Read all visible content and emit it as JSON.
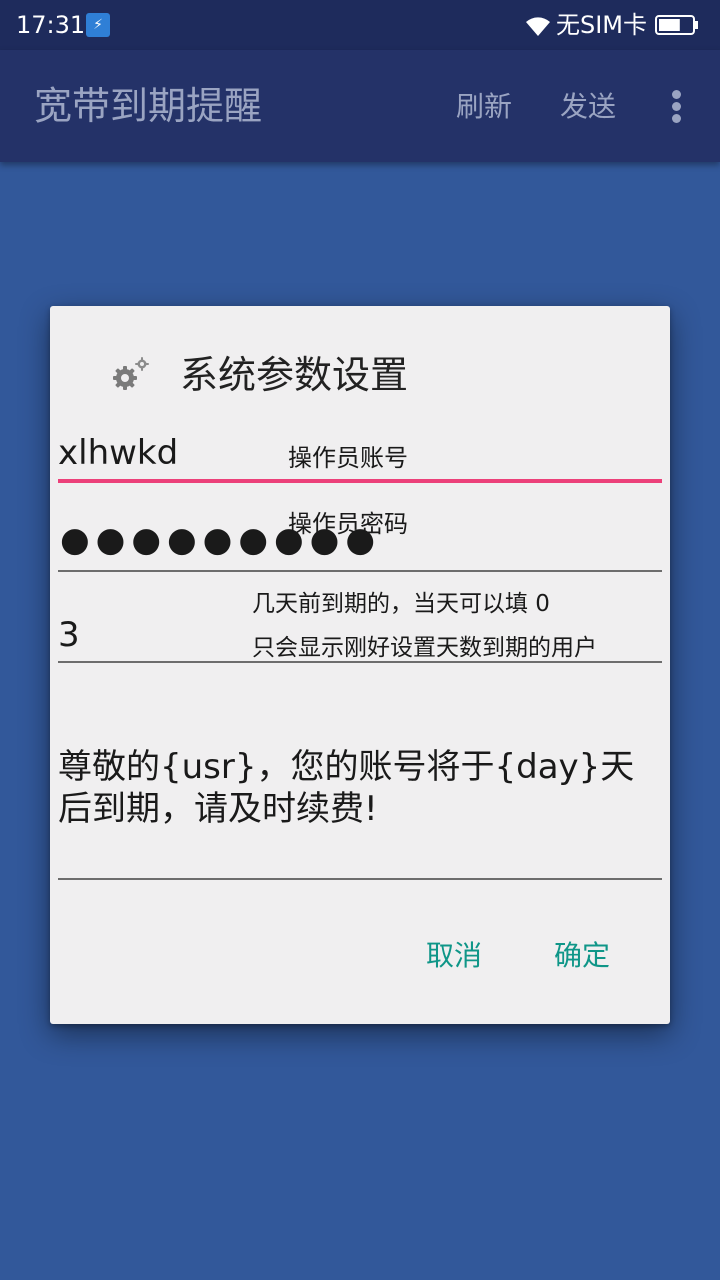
{
  "status_bar": {
    "time": "17:31",
    "app_icon_glyph": "⚡",
    "sim_status": "无SIM卡",
    "battery_level": 0.65,
    "icons": [
      "app-notification-icon",
      "wifi-icon",
      "battery-icon"
    ]
  },
  "app_bar": {
    "title": "宽带到期提醒",
    "actions": {
      "refresh": "刷新",
      "send": "发送"
    },
    "overflow_icon": "more-vert-icon"
  },
  "dialog": {
    "icon": "gear-icon",
    "title": "系统参数设置",
    "account": {
      "value": "xlhwkd",
      "label": "操作员账号"
    },
    "password": {
      "masked": "●●●●●●●●●",
      "label": "操作员密码"
    },
    "days": {
      "value": "3",
      "hint_line1": "几天前到期的，当天可以填 0",
      "hint_line2": "只会显示刚好设置天数到期的用户"
    },
    "message": {
      "value": "尊敬的{usr}，您的账号将于{day}天后到期，请及时续费!"
    },
    "buttons": {
      "cancel": "取消",
      "ok": "确定"
    }
  },
  "colors": {
    "status_bar": "#1e2b5c",
    "app_bar": "#243268",
    "background": "#32589a",
    "dialog": "#f0eff0",
    "focus_underline": "#ec407a",
    "button_text": "#0f9688"
  }
}
